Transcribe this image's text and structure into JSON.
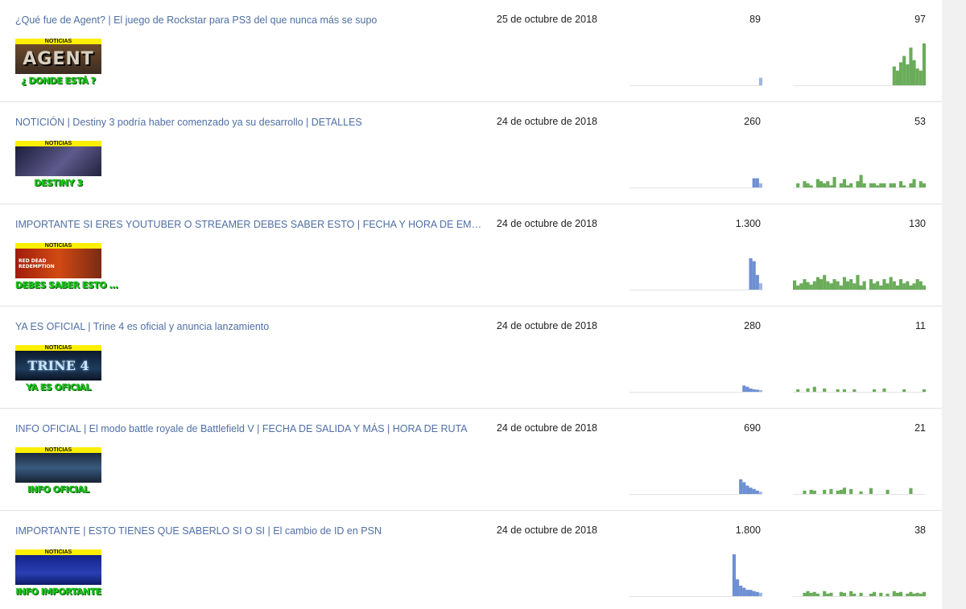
{
  "colors": {
    "link": "#4f6fa5",
    "views_bar": "#6d8fd3",
    "views_bar_light": "#9eb6e0",
    "engagement_bar": "#6aac5a",
    "thumb_band": "#ffef00",
    "thumb_caption": "#19c919"
  },
  "rows": [
    {
      "title": "¿Qué fue de Agent? | El juego de Rockstar para PS3 del que nunca más se supo",
      "thumb_band": "NOTICIAS",
      "thumb_art": "AGENT",
      "thumb_caption": "¿ DONDE ESTÁ ?",
      "date": "25 de octubre de 2018",
      "metric1": "89",
      "metric2": "97",
      "spark1": [
        0,
        0,
        0,
        0,
        0,
        0,
        0,
        0,
        0,
        0,
        0,
        0,
        0,
        0,
        0,
        0,
        0,
        0,
        0,
        0,
        0,
        0,
        0,
        0,
        0,
        0,
        0,
        0,
        0,
        0,
        0,
        0,
        0,
        0,
        0,
        0,
        0,
        0,
        0,
        0.18
      ],
      "spark2": [
        0,
        0,
        0,
        0,
        0,
        0,
        0,
        0,
        0,
        0,
        0,
        0,
        0,
        0,
        0,
        0,
        0,
        0,
        0,
        0,
        0,
        0,
        0,
        0,
        0,
        0,
        0,
        0,
        0,
        0,
        0.45,
        0.35,
        0.55,
        0.7,
        0.5,
        0.9,
        0.6,
        0.4,
        0.35,
        1.0
      ]
    },
    {
      "title": "NOTICIÓN | Destiny 3 podría haber comenzado ya su desarrollo | DETALLES",
      "thumb_band": "NOTICIAS",
      "thumb_art": "",
      "thumb_caption": "DESTINY 3",
      "date": "24 de octubre de 2018",
      "metric1": "260",
      "metric2": "53",
      "spark1": [
        0,
        0,
        0,
        0,
        0,
        0,
        0,
        0,
        0,
        0,
        0,
        0,
        0,
        0,
        0,
        0,
        0,
        0,
        0,
        0,
        0,
        0,
        0,
        0,
        0,
        0,
        0,
        0,
        0,
        0,
        0,
        0,
        0,
        0,
        0,
        0,
        0,
        0.22,
        0.22,
        0.1
      ],
      "spark2": [
        0,
        0.1,
        0,
        0.15,
        0.1,
        0.05,
        0,
        0.2,
        0.15,
        0.1,
        0.15,
        0.05,
        0.25,
        0,
        0.1,
        0.2,
        0.05,
        0.1,
        0,
        0.15,
        0.3,
        0.1,
        0,
        0.1,
        0.1,
        0.05,
        0.1,
        0.1,
        0,
        0.1,
        0.1,
        0,
        0.15,
        0.05,
        0,
        0.1,
        0.2,
        0,
        0.15,
        0.1
      ]
    },
    {
      "title": "IMPORTANTE SI ERES YOUTUBER O STREAMER DEBES SABER ESTO | FECHA Y HORA DE EMBARGO…",
      "thumb_band": "NOTICIAS",
      "thumb_art": "RED DEAD REDEMPTION",
      "thumb_caption": "DEBES SABER ESTO ...",
      "date": "24 de octubre de 2018",
      "metric1": "1.300",
      "metric2": "130",
      "spark1": [
        0,
        0,
        0,
        0,
        0,
        0,
        0,
        0,
        0,
        0,
        0,
        0,
        0,
        0,
        0,
        0,
        0,
        0,
        0,
        0,
        0,
        0,
        0,
        0,
        0,
        0,
        0,
        0,
        0,
        0,
        0,
        0,
        0,
        0,
        0,
        0,
        0.75,
        0.68,
        0.35,
        0.15
      ],
      "spark2": [
        0.22,
        0.1,
        0.15,
        0.25,
        0.18,
        0.12,
        0.2,
        0.3,
        0.25,
        0.35,
        0.2,
        0.15,
        0.25,
        0.2,
        0.1,
        0.3,
        0.2,
        0.25,
        0.15,
        0.35,
        0.1,
        0.2,
        0,
        0.25,
        0.15,
        0.2,
        0.1,
        0.25,
        0.15,
        0.3,
        0.2,
        0.1,
        0.25,
        0.15,
        0.2,
        0.1,
        0.15,
        0.25,
        0.2,
        0.1
      ]
    },
    {
      "title": "YA ES OFICIAL | Trine 4 es oficial y anuncia lanzamiento",
      "thumb_band": "NOTICIAS",
      "thumb_art": "TRINE 4",
      "thumb_caption": "YA ES OFICIAL",
      "date": "24 de octubre de 2018",
      "metric1": "280",
      "metric2": "11",
      "spark1": [
        0,
        0,
        0,
        0,
        0,
        0,
        0,
        0,
        0,
        0,
        0,
        0,
        0,
        0,
        0,
        0,
        0,
        0,
        0,
        0,
        0,
        0,
        0,
        0,
        0,
        0,
        0,
        0,
        0,
        0,
        0,
        0,
        0,
        0,
        0.15,
        0.12,
        0.08,
        0.06,
        0.05,
        0.04
      ],
      "spark2": [
        0,
        0.06,
        0,
        0,
        0.08,
        0,
        0.12,
        0,
        0,
        0.08,
        0,
        0,
        0,
        0.06,
        0,
        0.06,
        0,
        0,
        0.06,
        0,
        0,
        0,
        0,
        0,
        0.06,
        0,
        0,
        0.08,
        0,
        0,
        0,
        0,
        0,
        0.06,
        0,
        0,
        0,
        0,
        0,
        0.06
      ]
    },
    {
      "title": "INFO OFICIAL | El modo battle royale de Battlefield V | FECHA DE SALIDA Y MÁS | HORA DE RUTA",
      "thumb_band": "NOTICIAS",
      "thumb_art": "",
      "thumb_caption": "INFO OFICIAL",
      "date": "24 de octubre de 2018",
      "metric1": "690",
      "metric2": "21",
      "spark1": [
        0,
        0,
        0,
        0,
        0,
        0,
        0,
        0,
        0,
        0,
        0,
        0,
        0,
        0,
        0,
        0,
        0,
        0,
        0,
        0,
        0,
        0,
        0,
        0,
        0,
        0,
        0,
        0,
        0,
        0,
        0,
        0,
        0,
        0.35,
        0.28,
        0.2,
        0.15,
        0.12,
        0.08,
        0.05
      ],
      "spark2": [
        0,
        0,
        0,
        0.08,
        0,
        0.1,
        0.08,
        0,
        0,
        0.1,
        0,
        0.12,
        0,
        0.08,
        0.1,
        0.15,
        0,
        0.12,
        0,
        0,
        0.06,
        0,
        0,
        0.14,
        0,
        0,
        0,
        0,
        0.1,
        0,
        0,
        0,
        0,
        0,
        0,
        0.14,
        0,
        0,
        0,
        0
      ]
    },
    {
      "title": "IMPORTANTE | ESTO TIENES QUE SABERLO SI O SI | El cambio de ID en PSN",
      "thumb_band": "NOTICIAS",
      "thumb_art": "",
      "thumb_caption": "INFO IMPORTANTE",
      "date": "24 de octubre de 2018",
      "metric1": "1.800",
      "metric2": "38",
      "spark1": [
        0,
        0,
        0,
        0,
        0,
        0,
        0,
        0,
        0,
        0,
        0,
        0,
        0,
        0,
        0,
        0,
        0,
        0,
        0,
        0,
        0,
        0,
        0,
        0,
        0,
        0,
        0,
        0,
        0,
        0,
        0,
        1.0,
        0.4,
        0.25,
        0.2,
        0.15,
        0.15,
        0.12,
        0.1,
        0.08
      ],
      "spark2": [
        0,
        0,
        0,
        0.08,
        0.12,
        0.08,
        0.1,
        0.06,
        0,
        0.12,
        0.06,
        0.08,
        0,
        0,
        0.1,
        0.08,
        0,
        0.12,
        0.06,
        0,
        0.08,
        0,
        0,
        0.06,
        0.1,
        0,
        0.08,
        0,
        0.06,
        0,
        0.12,
        0.08,
        0.1,
        0,
        0.06,
        0.1,
        0.06,
        0.08,
        0.06,
        0.1
      ]
    }
  ]
}
